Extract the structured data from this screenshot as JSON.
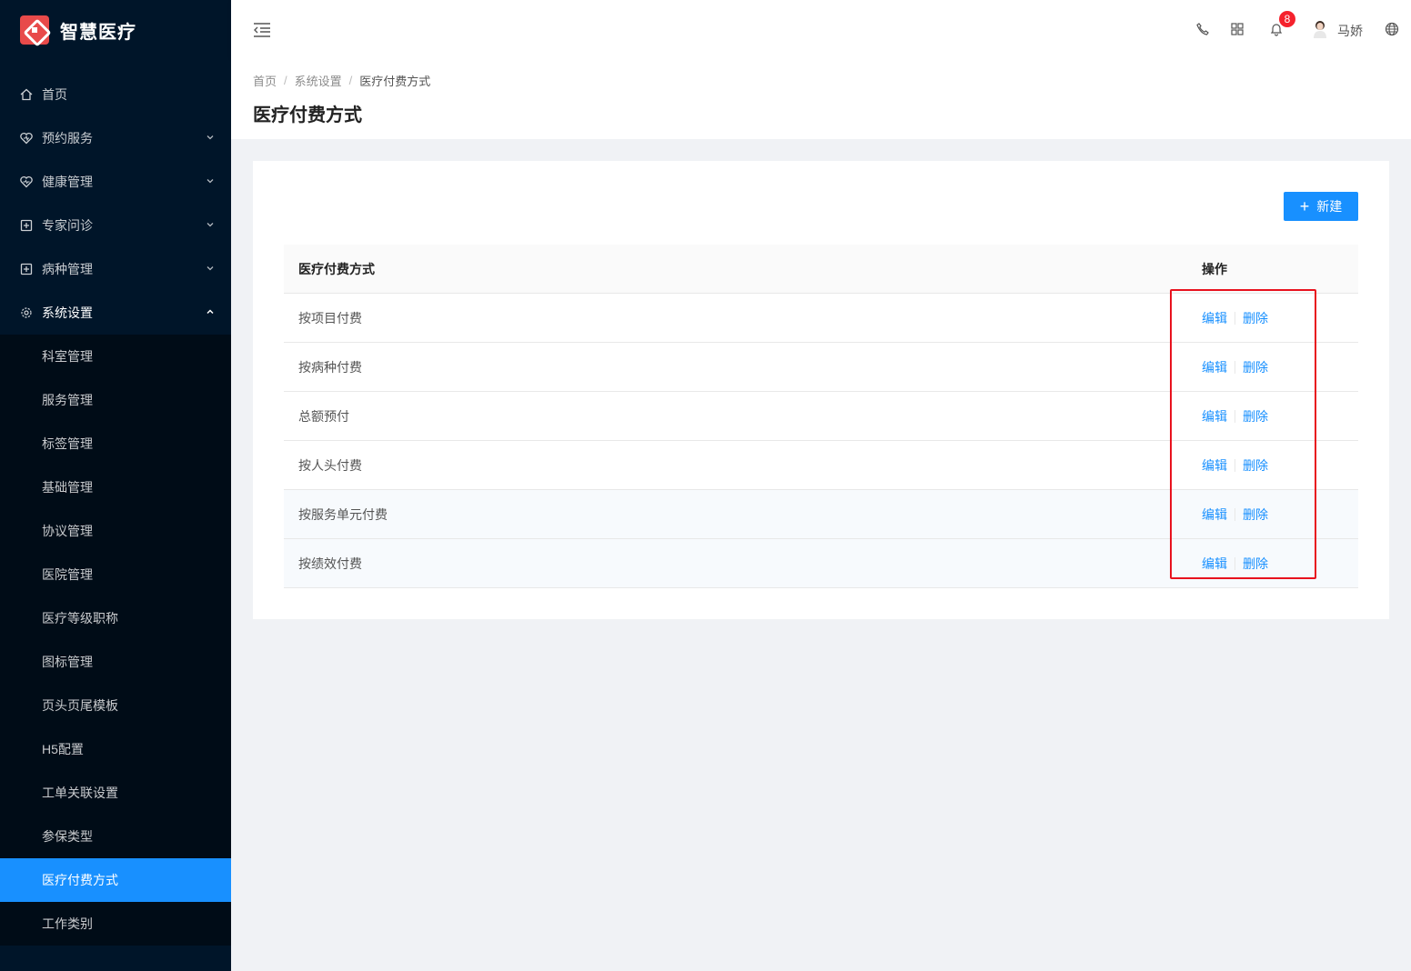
{
  "app": {
    "title": "智慧医疗"
  },
  "sidebar": {
    "items": [
      {
        "label": "首页",
        "icon": "home-icon"
      },
      {
        "label": "预约服务",
        "icon": "heart-icon"
      },
      {
        "label": "健康管理",
        "icon": "heart-pulse-icon"
      },
      {
        "label": "专家问诊",
        "icon": "plus-square-icon"
      },
      {
        "label": "病种管理",
        "icon": "plus-square-icon"
      },
      {
        "label": "系统设置",
        "icon": "gear-icon"
      }
    ],
    "submenu": [
      {
        "label": "科室管理"
      },
      {
        "label": "服务管理"
      },
      {
        "label": "标签管理"
      },
      {
        "label": "基础管理"
      },
      {
        "label": "协议管理"
      },
      {
        "label": "医院管理"
      },
      {
        "label": "医疗等级职称"
      },
      {
        "label": "图标管理"
      },
      {
        "label": "页头页尾模板"
      },
      {
        "label": "H5配置"
      },
      {
        "label": "工单关联设置"
      },
      {
        "label": "参保类型"
      },
      {
        "label": "医疗付费方式"
      },
      {
        "label": "工作类别"
      }
    ]
  },
  "header": {
    "notification_count": "8",
    "user_name": "马娇"
  },
  "breadcrumb": [
    "首页",
    "系统设置",
    "医疗付费方式"
  ],
  "page": {
    "title": "医疗付费方式"
  },
  "toolbar": {
    "new_label": "新建"
  },
  "table": {
    "columns": [
      "医疗付费方式",
      "操作"
    ],
    "rows": [
      {
        "name": "按项目付费",
        "edit": "编辑",
        "delete": "删除"
      },
      {
        "name": "按病种付费",
        "edit": "编辑",
        "delete": "删除"
      },
      {
        "name": "总额预付",
        "edit": "编辑",
        "delete": "删除"
      },
      {
        "name": "按人头付费",
        "edit": "编辑",
        "delete": "删除"
      },
      {
        "name": "按服务单元付费",
        "edit": "编辑",
        "delete": "删除"
      },
      {
        "name": "按绩效付费",
        "edit": "编辑",
        "delete": "删除"
      }
    ]
  },
  "colors": {
    "primary": "#1890ff",
    "sidebar_bg": "#001529",
    "highlight": "#e8121e",
    "badge": "#f5222d"
  }
}
